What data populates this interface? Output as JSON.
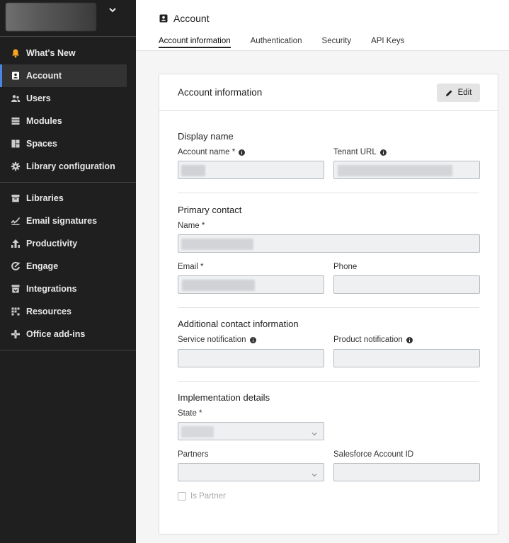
{
  "sidebar": {
    "icons": {
      "tenant_chevron": "chevron-down-icon"
    },
    "group1": [
      {
        "label": "What's New",
        "icon": "bell-icon",
        "icon_color": "#f5a623"
      },
      {
        "label": "Account",
        "icon": "account-card-icon",
        "active": true
      },
      {
        "label": "Users",
        "icon": "users-icon"
      },
      {
        "label": "Modules",
        "icon": "modules-icon"
      },
      {
        "label": "Spaces",
        "icon": "spaces-icon"
      },
      {
        "label": "Library configuration",
        "icon": "gear-icon"
      }
    ],
    "group2": [
      {
        "label": "Libraries",
        "icon": "archive-icon"
      },
      {
        "label": "Email signatures",
        "icon": "signature-icon"
      },
      {
        "label": "Productivity",
        "icon": "productivity-icon"
      },
      {
        "label": "Engage",
        "icon": "engage-icon"
      },
      {
        "label": "Integrations",
        "icon": "integrations-icon"
      },
      {
        "label": "Resources",
        "icon": "resources-icon"
      },
      {
        "label": "Office add-ins",
        "icon": "office-addins-icon"
      }
    ],
    "active_color": "#4a86e8"
  },
  "header": {
    "title": "Account",
    "tabs": [
      {
        "label": "Account information",
        "active": true
      },
      {
        "label": "Authentication"
      },
      {
        "label": "Security"
      },
      {
        "label": "API Keys"
      }
    ]
  },
  "card": {
    "title": "Account information",
    "edit_label": "Edit",
    "display_name": {
      "title": "Display name",
      "account_name_label": "Account name *",
      "tenant_url_label": "Tenant URL"
    },
    "primary_contact": {
      "title": "Primary contact",
      "name_label": "Name *",
      "email_label": "Email *",
      "phone_label": "Phone"
    },
    "additional_contact": {
      "title": "Additional contact information",
      "service_label": "Service notification",
      "product_label": "Product notification"
    },
    "implementation": {
      "title": "Implementation details",
      "state_label": "State *",
      "partners_label": "Partners",
      "salesforce_label": "Salesforce Account ID",
      "is_partner_label": "Is Partner"
    }
  }
}
